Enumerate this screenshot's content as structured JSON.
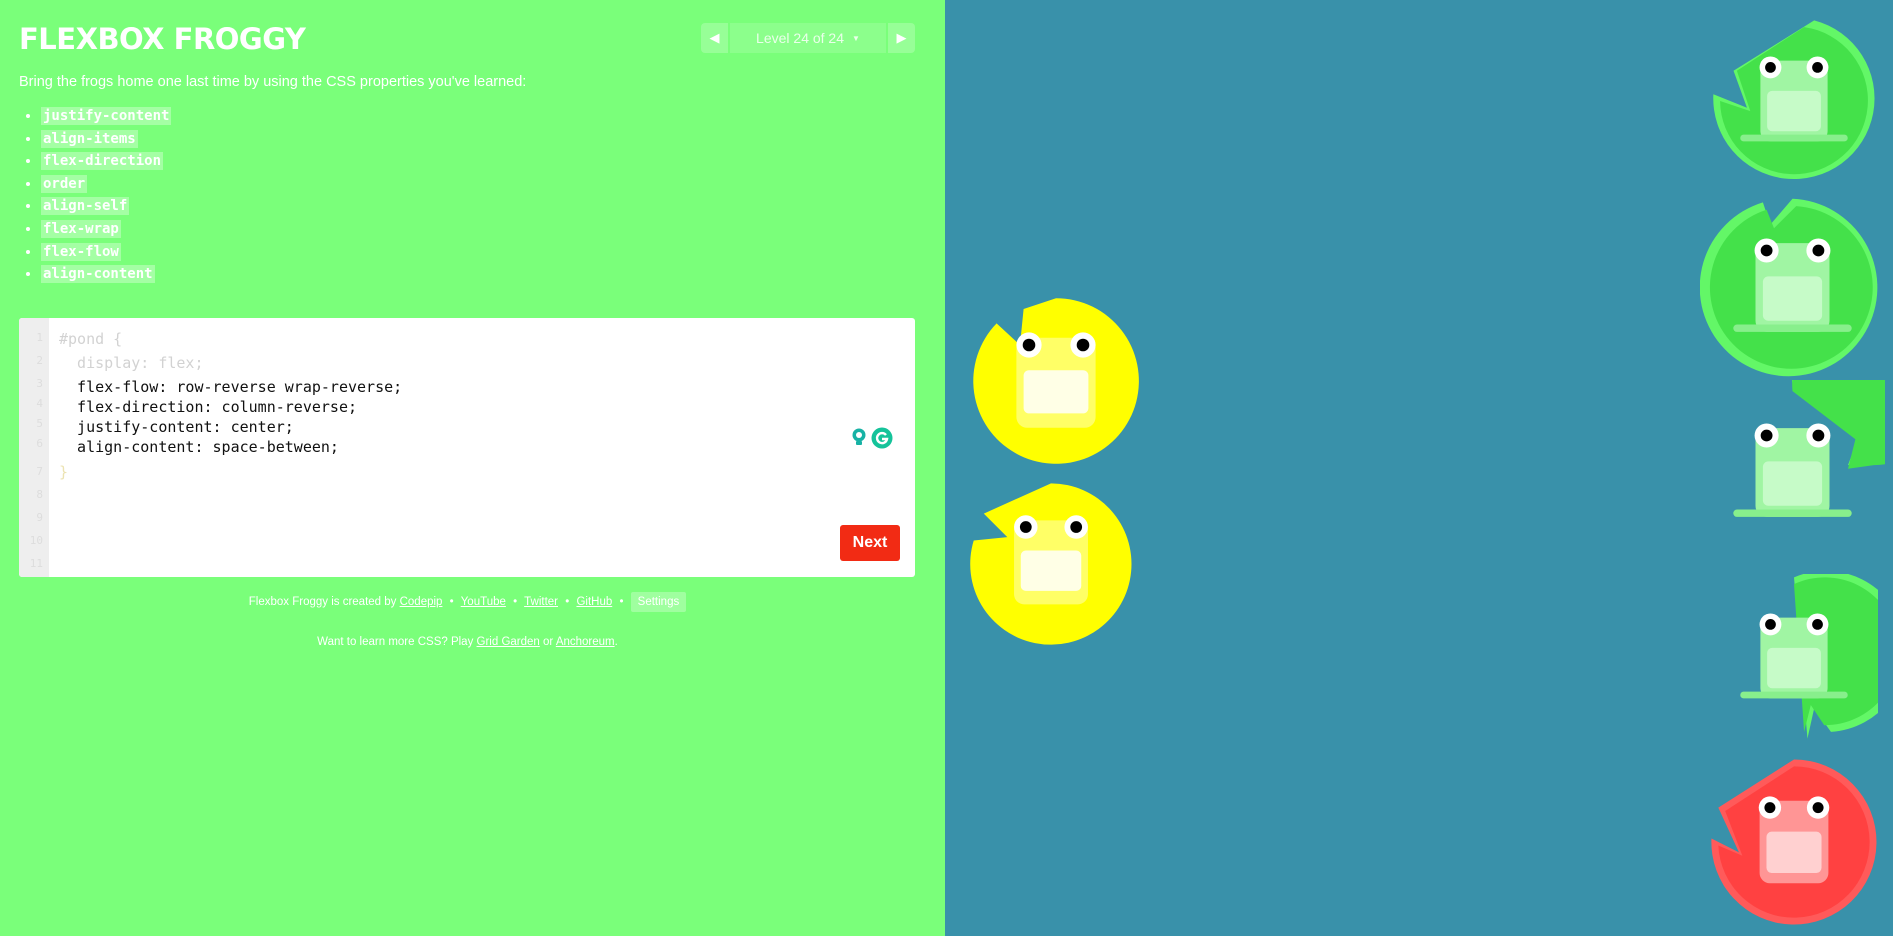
{
  "app": {
    "title": "FLEXBOX FROGGY"
  },
  "level_nav": {
    "prev_icon": "triangle-left-icon",
    "label": "Level 24 of 24",
    "dropdown_icon": "chevron-down-icon",
    "next_icon": "triangle-right-icon"
  },
  "instructions": "Bring the frogs home one last time by using the CSS properties you've learned:",
  "properties": [
    "justify-content",
    "align-items",
    "flex-direction",
    "order",
    "align-self",
    "flex-wrap",
    "flex-flow",
    "align-content"
  ],
  "editor": {
    "line_numbers": [
      "1",
      "2",
      "3",
      "4",
      "5",
      "6",
      "7",
      "8",
      "9",
      "10",
      "11"
    ],
    "selector": "#pond {",
    "fixed_line": "  display: flex;",
    "user_lines": [
      "  flex-flow: row-reverse wrap-reverse;",
      "  flex-direction: column-reverse;",
      "  justify-content: center;",
      "  align-content: space-between;"
    ],
    "closing": "}",
    "next_label": "Next"
  },
  "credits": {
    "prefix": "Flexbox Froggy is created by",
    "codepip": "Codepip",
    "youtube": "YouTube",
    "twitter": "Twitter",
    "github": "GitHub",
    "sep": "•",
    "settings": "Settings"
  },
  "learn_more": {
    "prefix": "Want to learn more CSS? Play",
    "grid_garden": "Grid Garden",
    "middle": "or",
    "anchoreum": "Anchoreum",
    "suffix": "."
  },
  "pond": {
    "frogs": [
      {
        "color": "yellow",
        "kind": "frog"
      },
      {
        "color": "yellow",
        "kind": "frog"
      }
    ],
    "lilypads": [
      {
        "color": "green"
      },
      {
        "color": "green"
      },
      {
        "color": "green"
      },
      {
        "color": "green"
      },
      {
        "color": "red"
      }
    ]
  },
  "colors": {
    "sidebar_bg": "#7aff7a",
    "pond_bg": "#3991aa",
    "next_button": "#f22b14",
    "frog_yellow": "#ffff00",
    "frog_green": "#44e14a",
    "frog_red": "#ff4141"
  }
}
